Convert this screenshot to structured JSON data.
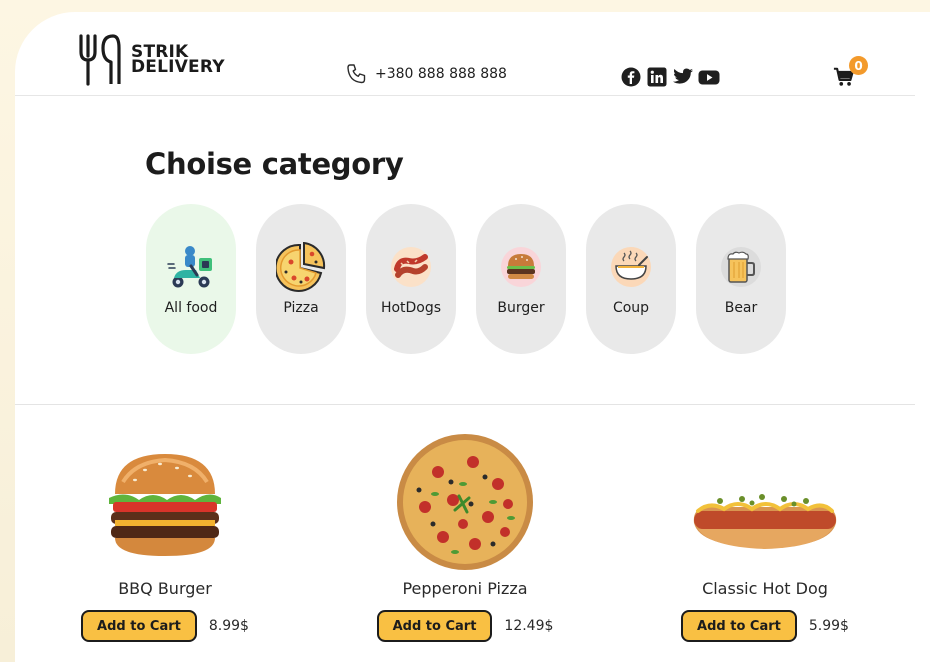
{
  "brand": {
    "line1": "STRIK",
    "line2": "DELIVERY"
  },
  "header": {
    "phone": "+380 888 888 888",
    "socials": [
      "facebook-icon",
      "linkedin-icon",
      "twitter-icon",
      "youtube-icon"
    ],
    "cart_count": "0"
  },
  "category": {
    "title": "Choise category",
    "items": [
      {
        "label": "All food",
        "icon": "delivery-scooter-icon",
        "active": true
      },
      {
        "label": "Pizza",
        "icon": "pizza-icon",
        "active": false
      },
      {
        "label": "HotDogs",
        "icon": "sausage-icon",
        "active": false
      },
      {
        "label": "Burger",
        "icon": "burger-icon",
        "active": false
      },
      {
        "label": "Coup",
        "icon": "soup-icon",
        "active": false
      },
      {
        "label": "Bear",
        "icon": "beer-mug-icon",
        "active": false
      }
    ]
  },
  "products": [
    {
      "name": "BBQ Burger",
      "button": "Add to Cart",
      "price": "8.99$"
    },
    {
      "name": "Pepperoni Pizza",
      "button": "Add to Cart",
      "price": "12.49$"
    },
    {
      "name": "Classic Hot Dog",
      "button": "Add to Cart",
      "price": "5.99$"
    }
  ],
  "colors": {
    "accent": "#f9c043",
    "badge": "#f39a2b",
    "active_cat": "#eaf8e9",
    "cat_bg": "#e9e9e9"
  }
}
